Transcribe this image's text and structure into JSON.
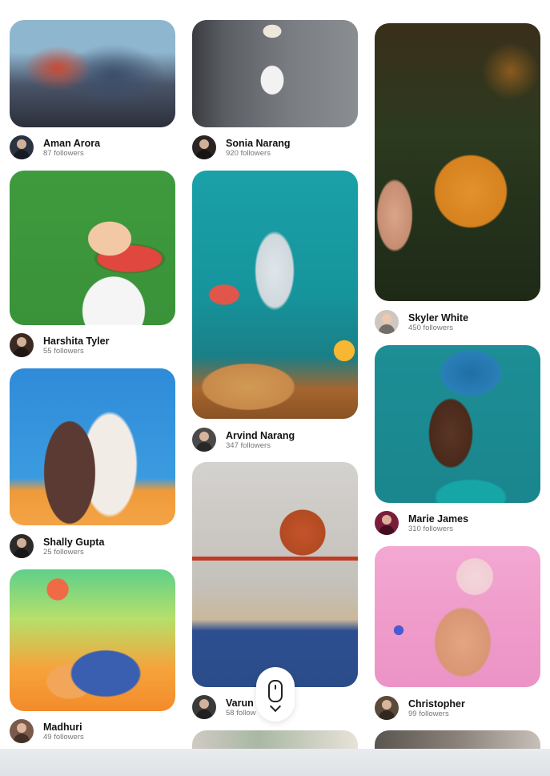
{
  "pins": [
    {
      "user": "Aman Arora",
      "followers": "87 followers",
      "image": "elephant-mural"
    },
    {
      "user": "Harshita Tyler",
      "followers": "55 followers",
      "image": "child-watermelon"
    },
    {
      "user": "Shally Gupta",
      "followers": "25 followers",
      "image": "two-women-sky"
    },
    {
      "user": "Madhuri",
      "followers": "49 followers",
      "image": "3d-character"
    },
    {
      "user": "Sonia Narang",
      "followers": "920 followers",
      "image": "deer-lamp"
    },
    {
      "user": "Arvind Narang",
      "followers": "347 followers",
      "image": "water-bottle-fruits"
    },
    {
      "user": "Varun N",
      "followers": "58 follow",
      "image": "basketball-hoop"
    },
    {
      "user": "Skyler White",
      "followers": "450 followers",
      "image": "coffee-mug"
    },
    {
      "user": "Marie James",
      "followers": "310 followers",
      "image": "woman-turban"
    },
    {
      "user": "Christopher",
      "followers": "99 followers",
      "image": "3d-figure-pink"
    }
  ],
  "scroll_hint": {
    "icon": "mouse-scroll-icon"
  }
}
